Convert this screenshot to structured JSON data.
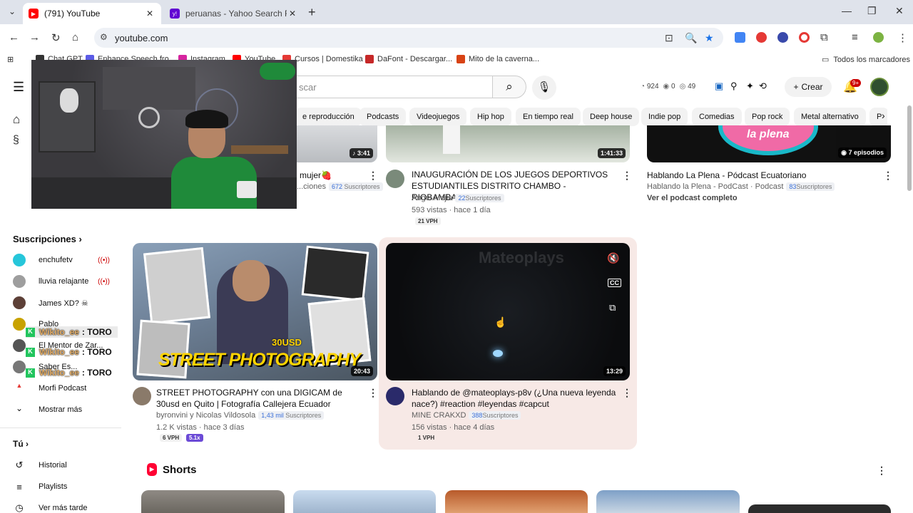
{
  "browser": {
    "tabs": [
      {
        "title": "(791) YouTube",
        "favicon": "youtube-icon",
        "active": true
      },
      {
        "title": "peruanas - Yahoo Search Results",
        "favicon": "yahoo-icon",
        "active": false
      }
    ],
    "url": "youtube.com",
    "bookmarks": [
      "Chat GPT",
      "Enhance Speech fro",
      "Instagram",
      "YouTube",
      "Cursos | Domestika",
      "DaFont - Descargar...",
      "Mito de la caverna..."
    ],
    "all_bookmarks_label": "Todos los marcadores"
  },
  "header": {
    "search_placeholder": "Buscar",
    "search_visible": "scar",
    "stats": {
      "views": "924",
      "a": "0",
      "b": "49"
    },
    "create_label": "Crear",
    "notifications_badge": "9+"
  },
  "chips": [
    "e reproducción",
    "Podcasts",
    "Videojuegos",
    "Hip hop",
    "En tiempo real",
    "Deep house",
    "Indie pop",
    "Comedias",
    "Pop rock",
    "Metal alternativo",
    "P"
  ],
  "sidebar": {
    "subscriptions_title": "Suscripciones",
    "subscriptions": [
      {
        "name": "enchufetv",
        "live": true,
        "color": "#26c6da"
      },
      {
        "name": "lluvia relajante",
        "live": true,
        "color": "#9e9e9e"
      },
      {
        "name": "James XD? ☠",
        "live": false,
        "color": "#5d4037"
      },
      {
        "name": "Pablo",
        "live": false,
        "color": "#c8a200"
      },
      {
        "name": "El Mentor de Zar...",
        "live": false,
        "color": "#555555"
      },
      {
        "name": "Saber Es...",
        "live": false,
        "color": "#777777"
      },
      {
        "name": "Morfi Podcast",
        "live": false,
        "color": "#e53935"
      }
    ],
    "show_more": "Mostrar más",
    "you_title": "Tú",
    "you_items": [
      "Historial",
      "Playlists",
      "Ver más tarde"
    ]
  },
  "chat": [
    {
      "nick": "Wikito_ee",
      "msg": ": TORO"
    },
    {
      "nick": "Wikito_ee",
      "msg": ": TORO"
    },
    {
      "nick": "Wikito_ee",
      "msg": ": TORO"
    }
  ],
  "videos_top": [
    {
      "title": "mujer🍓",
      "channel": "...ciones",
      "subs": "672",
      "duration": "3:41"
    },
    {
      "title": "INAUGURACIÓN DE LOS JUEGOS DEPORTIVOS ESTUDIANTILES DISTRITO CHAMBO - RIOBAMBA....",
      "channel": "Angel Mejia",
      "subs": "22",
      "meta": "593 vistas · hace 1 día",
      "vph": "21 VPH",
      "duration": "1:41:33"
    },
    {
      "title": "Hablando La Plena - Pódcast Ecuatoriano",
      "channel": "Hablando la Plena - PodCast · Podcast",
      "subs": "83",
      "extra": "Ver el podcast completo",
      "duration": "7 episodios"
    }
  ],
  "subs_word": "Suscriptores",
  "videos_mid": [
    {
      "title": "STREET PHOTOGRAPHY con una DIGICAM de 30usd en Quito | Fotografía Callejera Ecuador",
      "channel": "byronvini y Nicolas Vildosola",
      "subs": "1,43 mil",
      "meta": "1.2 K vistas · hace 3 días",
      "vph": "6 VPH",
      "ratio": "5.1x",
      "duration": "20:43",
      "thumb_text": "STREET PHOTOGRAPHY",
      "thumb_sub": "30USD"
    },
    {
      "title": "Hablando de @mateoplays-p8v (¿Una nueva leyenda nace?) #reaction #leyendas #capcut",
      "channel": "MINE CRAKXD",
      "subs": "388",
      "meta": "156 vistas · hace 4 días",
      "vph": "1 VPH",
      "duration": "13:29",
      "thumb_text": "Mateoplays"
    }
  ],
  "top_right_thumb_text": "la plena",
  "shorts_title": "Shorts",
  "colors": {
    "youtube_red": "#ff0033",
    "hover_bg": "#f7e9e6",
    "accent_blue": "#3a6fd8"
  }
}
